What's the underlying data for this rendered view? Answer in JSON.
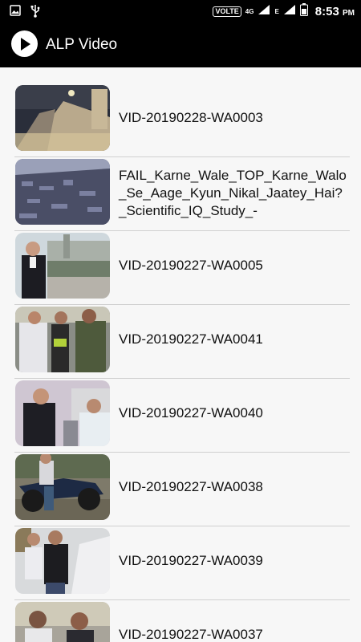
{
  "status_bar": {
    "time": "8:53",
    "ampm": "PM",
    "volte": "VOLTE",
    "net1": "4G",
    "net2": "E",
    "icons": [
      "gallery-icon",
      "usb-icon",
      "signal-icon",
      "battery-icon"
    ]
  },
  "app": {
    "title": "ALP Video"
  },
  "videos": [
    {
      "title": "VID-20190228-WA0003"
    },
    {
      "title": "FAIL_Karne_Wale_TOP_Karne_Walo_Se_Aage_Kyun_Nikal_Jaatey_Hai?_Scientific_IQ_Study_-"
    },
    {
      "title": "VID-20190227-WA0005"
    },
    {
      "title": "VID-20190227-WA0041"
    },
    {
      "title": "VID-20190227-WA0040"
    },
    {
      "title": "VID-20190227-WA0038"
    },
    {
      "title": "VID-20190227-WA0039"
    },
    {
      "title": "VID-20190227-WA0037"
    }
  ]
}
